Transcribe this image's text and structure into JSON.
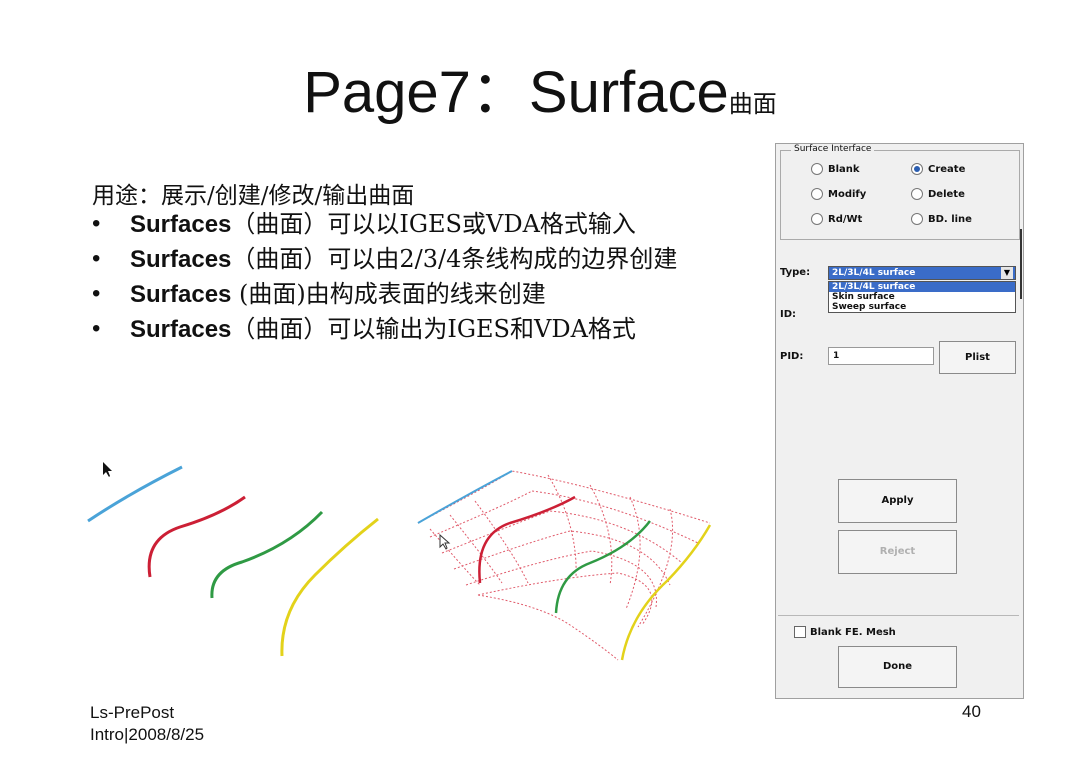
{
  "slide": {
    "title_main": "Page7：Surface",
    "title_sub": "曲面",
    "purpose": "用途：展示/创建/修改/输出曲面",
    "bullets": [
      {
        "bold": "Surfaces",
        "rest": "（曲面）可以以IGES或VDA格式输入"
      },
      {
        "bold": "Surfaces",
        "rest": "（曲面）可以由2/3/4条线构成的边界创建"
      },
      {
        "bold": "Surfaces",
        "rest": " (曲面)由构成表面的线来创建"
      },
      {
        "bold": "Surfaces",
        "rest": "（曲面）可以输出为IGES和VDA格式"
      }
    ],
    "footer_line1": "Ls-PrePost",
    "footer_line2": "Intro|2008/8/25",
    "page_number": "40"
  },
  "dialog": {
    "group_title": "Surface Interface",
    "radios": [
      {
        "label": "Blank",
        "checked": false
      },
      {
        "label": "Create",
        "checked": true
      },
      {
        "label": "Modify",
        "checked": false
      },
      {
        "label": "Delete",
        "checked": false
      },
      {
        "label": "Rd/Wt",
        "checked": false
      },
      {
        "label": "BD. line",
        "checked": false
      }
    ],
    "type_label": "Type:",
    "type_value": "2L/3L/4L surface",
    "type_options": [
      "2L/3L/4L surface",
      "Skin surface",
      "Sweep surface"
    ],
    "id_label": "ID:",
    "pid_label": "PID:",
    "pid_value": "1",
    "plist_label": "Plist",
    "apply_label": "Apply",
    "reject_label": "Reject",
    "blank_mesh_label": "Blank FE. Mesh",
    "blank_mesh_checked": false,
    "done_label": "Done"
  },
  "colors": {
    "curve1": "#4aa3d8",
    "curve2": "#cc1f35",
    "curve3": "#2f9a44",
    "curve4": "#e3d21a",
    "mesh": "#e05a6a",
    "accent": "#3a6cc8"
  },
  "icons": [
    "cursor-icon",
    "radio-icon",
    "dropdown-arrow-icon",
    "checkbox-icon"
  ]
}
